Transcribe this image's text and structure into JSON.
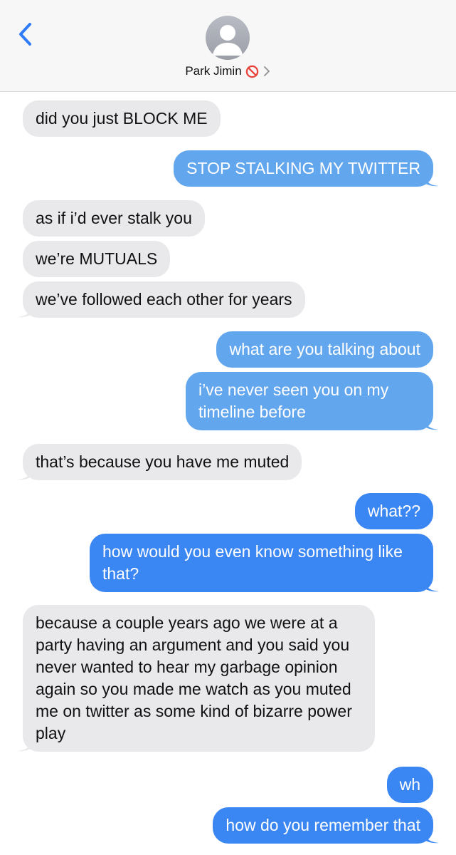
{
  "header": {
    "contact_name": "Park Jimin",
    "status_icon": "blocked-icon",
    "chevron": "chevron-right-icon"
  },
  "colors": {
    "received_bubble": "#e9e9eb",
    "sent_light": "#62a6ee",
    "sent_dark": "#3a86f2",
    "accent_blue": "#2f7cf6"
  },
  "messages": [
    {
      "from": "them",
      "text": "did you just BLOCK ME"
    },
    {
      "from": "me",
      "text": "STOP STALKING MY TWITTER"
    },
    {
      "from": "them",
      "text": "as if i’d ever stalk you"
    },
    {
      "from": "them",
      "text": "we’re MUTUALS"
    },
    {
      "from": "them",
      "text": "we’ve followed each other for years"
    },
    {
      "from": "me",
      "text": "what are you talking about"
    },
    {
      "from": "me",
      "text": "i’ve never seen you on my timeline before"
    },
    {
      "from": "them",
      "text": "that’s because you have me muted"
    },
    {
      "from": "me",
      "text": "what??"
    },
    {
      "from": "me",
      "text": "how would you even know something like that?"
    },
    {
      "from": "them",
      "text": "because a couple years ago we were at a party having an argument and you said you never wanted to hear my garbage opinion again so you made me watch as you muted me on twitter as some kind of bizarre power play"
    },
    {
      "from": "me",
      "text": "wh"
    },
    {
      "from": "me",
      "text": "how do you remember that"
    }
  ]
}
